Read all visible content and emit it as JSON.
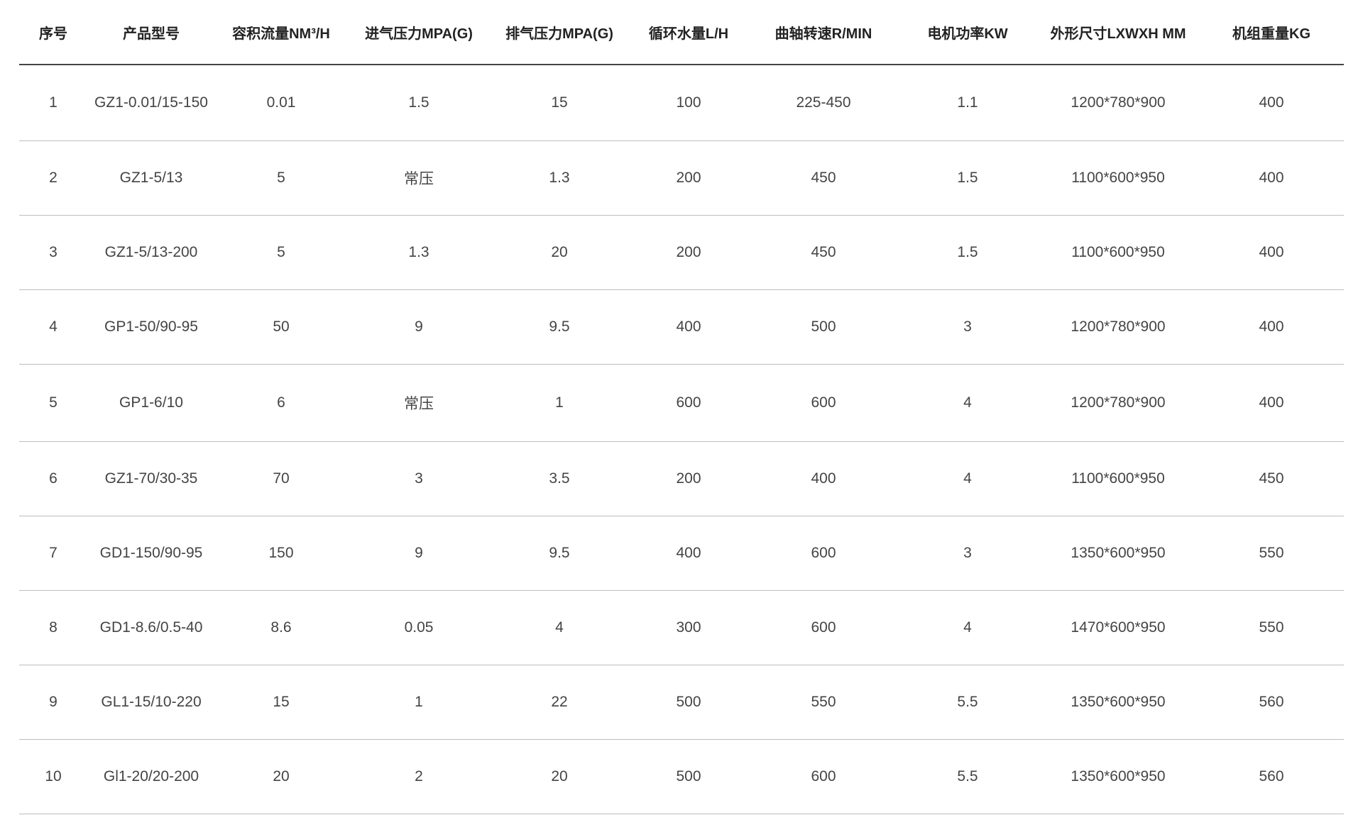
{
  "table": {
    "headers": [
      "序号",
      "产品型号",
      "容积流量NM³/H",
      "进气压力MPA(G)",
      "排气压力MPA(G)",
      "循环水量L/H",
      "曲轴转速R/MIN",
      "电机功率KW",
      "外形尺寸LXWXH MM",
      "机组重量KG"
    ],
    "rows": [
      [
        "1",
        "GZ1-0.01/15-150",
        "0.01",
        "1.5",
        "15",
        "100",
        "225-450",
        "1.1",
        "1200*780*900",
        "400"
      ],
      [
        "2",
        "GZ1-5/13",
        "5",
        "常压",
        "1.3",
        "200",
        "450",
        "1.5",
        "1100*600*950",
        "400"
      ],
      [
        "3",
        "GZ1-5/13-200",
        "5",
        "1.3",
        "20",
        "200",
        "450",
        "1.5",
        "1100*600*950",
        "400"
      ],
      [
        "4",
        "GP1-50/90-95",
        "50",
        "9",
        "9.5",
        "400",
        "500",
        "3",
        "1200*780*900",
        "400"
      ],
      [
        "5",
        "GP1-6/10",
        "6",
        "常压",
        "1",
        "600",
        "600",
        "4",
        "1200*780*900",
        "400"
      ],
      [
        "6",
        "GZ1-70/30-35",
        "70",
        "3",
        "3.5",
        "200",
        "400",
        "4",
        "1100*600*950",
        "450"
      ],
      [
        "7",
        "GD1-150/90-95",
        "150",
        "9",
        "9.5",
        "400",
        "600",
        "3",
        "1350*600*950",
        "550"
      ],
      [
        "8",
        "GD1-8.6/0.5-40",
        "8.6",
        "0.05",
        "4",
        "300",
        "600",
        "4",
        "1470*600*950",
        "550"
      ],
      [
        "9",
        "GL1-15/10-220",
        "15",
        "1",
        "22",
        "500",
        "550",
        "5.5",
        "1350*600*950",
        "560"
      ],
      [
        "10",
        "Gl1-20/20-200",
        "20",
        "2",
        "20",
        "500",
        "600",
        "5.5",
        "1350*600*950",
        "560"
      ]
    ]
  }
}
